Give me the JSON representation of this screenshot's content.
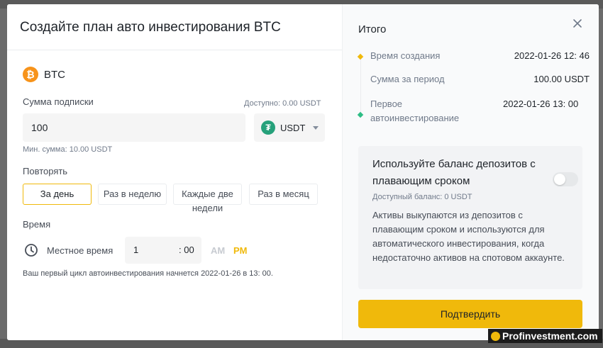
{
  "modal": {
    "title": "Создайте план авто инвестирования BTC",
    "coin": {
      "name": "BTC",
      "symbol": "₿"
    },
    "subscription": {
      "label": "Сумма подписки",
      "available": "Доступно: 0.00 USDT",
      "amount": "100",
      "currency": "USDT",
      "currency_symbol": "₮",
      "min_sum": "Мин. сумма: 10.00 USDT"
    },
    "repeat": {
      "label": "Повторять",
      "options": [
        "За день",
        "Раз в неделю",
        "Каждые две недели",
        "Раз в месяц"
      ],
      "selected": "За день"
    },
    "time": {
      "label": "Время",
      "local_label": "Местное время",
      "hour": "1",
      "minutes": ": 00",
      "am": "AM",
      "pm": "PM",
      "selected_meridiem": "PM"
    },
    "footnote": "Ваш первый цикл автоинвестирования начнется 2022-01-26 в 13: 00."
  },
  "summary": {
    "title": "Итого",
    "rows": [
      {
        "label": "Время создания",
        "value": "2022-01-26 12: 46"
      },
      {
        "label": "Сумма за период",
        "value": "100.00 USDT"
      },
      {
        "label": "Первое автоинвестирование",
        "value": "2022-01-26 13: 00"
      }
    ],
    "deposit_card": {
      "title": "Используйте баланс депозитов с плавающим сроком",
      "balance": "Доступный баланс: 0 USDT",
      "description": "Активы выкупаются из депозитов с плавающим сроком и используются для автоматического инвестирования, когда недостаточно активов на спотовом аккаунте.",
      "toggle_on": false
    },
    "confirm_label": "Подтвердить"
  },
  "watermark": "Profinvestment.com",
  "colors": {
    "accent": "#f0b90b",
    "btc": "#f7931a",
    "usdt": "#26a17b",
    "timeline_start": "#f0b90b",
    "timeline_end": "#2ebd85"
  },
  "icons": [
    "bitcoin-icon",
    "tether-icon",
    "caret-down-icon",
    "clock-icon",
    "close-icon"
  ]
}
